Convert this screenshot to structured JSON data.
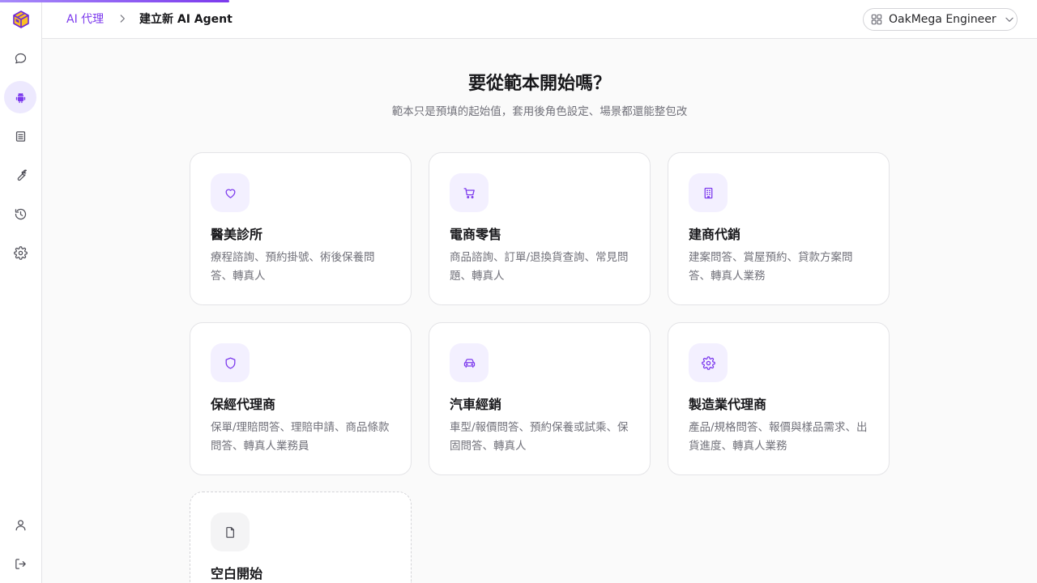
{
  "breadcrumb": {
    "parent": "AI 代理",
    "current": "建立新 AI Agent"
  },
  "workspace": {
    "label": "OakMega Engineer"
  },
  "header": {
    "title": "要從範本開始嗎？",
    "subtitle": "範本只是預填的起始值，套用後角色設定、場景都還能整包改"
  },
  "sidebar": {
    "items": [
      {
        "name": "chat-icon"
      },
      {
        "name": "robot-icon",
        "active": true
      },
      {
        "name": "document-icon"
      },
      {
        "name": "wrench-icon"
      },
      {
        "name": "history-icon"
      },
      {
        "name": "gear-icon"
      },
      {
        "name": "user-icon"
      },
      {
        "name": "logout-icon"
      }
    ]
  },
  "templates": [
    {
      "icon": "heart-icon",
      "title": "醫美診所",
      "desc": "療程諮詢、預約掛號、術後保養問答、轉真人"
    },
    {
      "icon": "cart-icon",
      "title": "電商零售",
      "desc": "商品諮詢、訂單/退換貨查詢、常見問題、轉真人"
    },
    {
      "icon": "building-icon",
      "title": "建商代銷",
      "desc": "建案問答、賞屋預約、貸款方案問答、轉真人業務"
    },
    {
      "icon": "shield-icon",
      "title": "保經代理商",
      "desc": "保單/理賠問答、理賠申請、商品條款問答、轉真人業務員"
    },
    {
      "icon": "car-icon",
      "title": "汽車經銷",
      "desc": "車型/報價問答、預約保養或試乘、保固問答、轉真人"
    },
    {
      "icon": "gear-icon",
      "title": "製造業代理商",
      "desc": "產品/規格問答、報價與樣品需求、出貨進度、轉真人業務"
    },
    {
      "icon": "file-icon",
      "title": "空白開始",
      "desc": ""
    }
  ],
  "colors": {
    "accent": "#7c3aed",
    "accent_soft": "#f3f0ff",
    "border": "#e4e4e7"
  }
}
